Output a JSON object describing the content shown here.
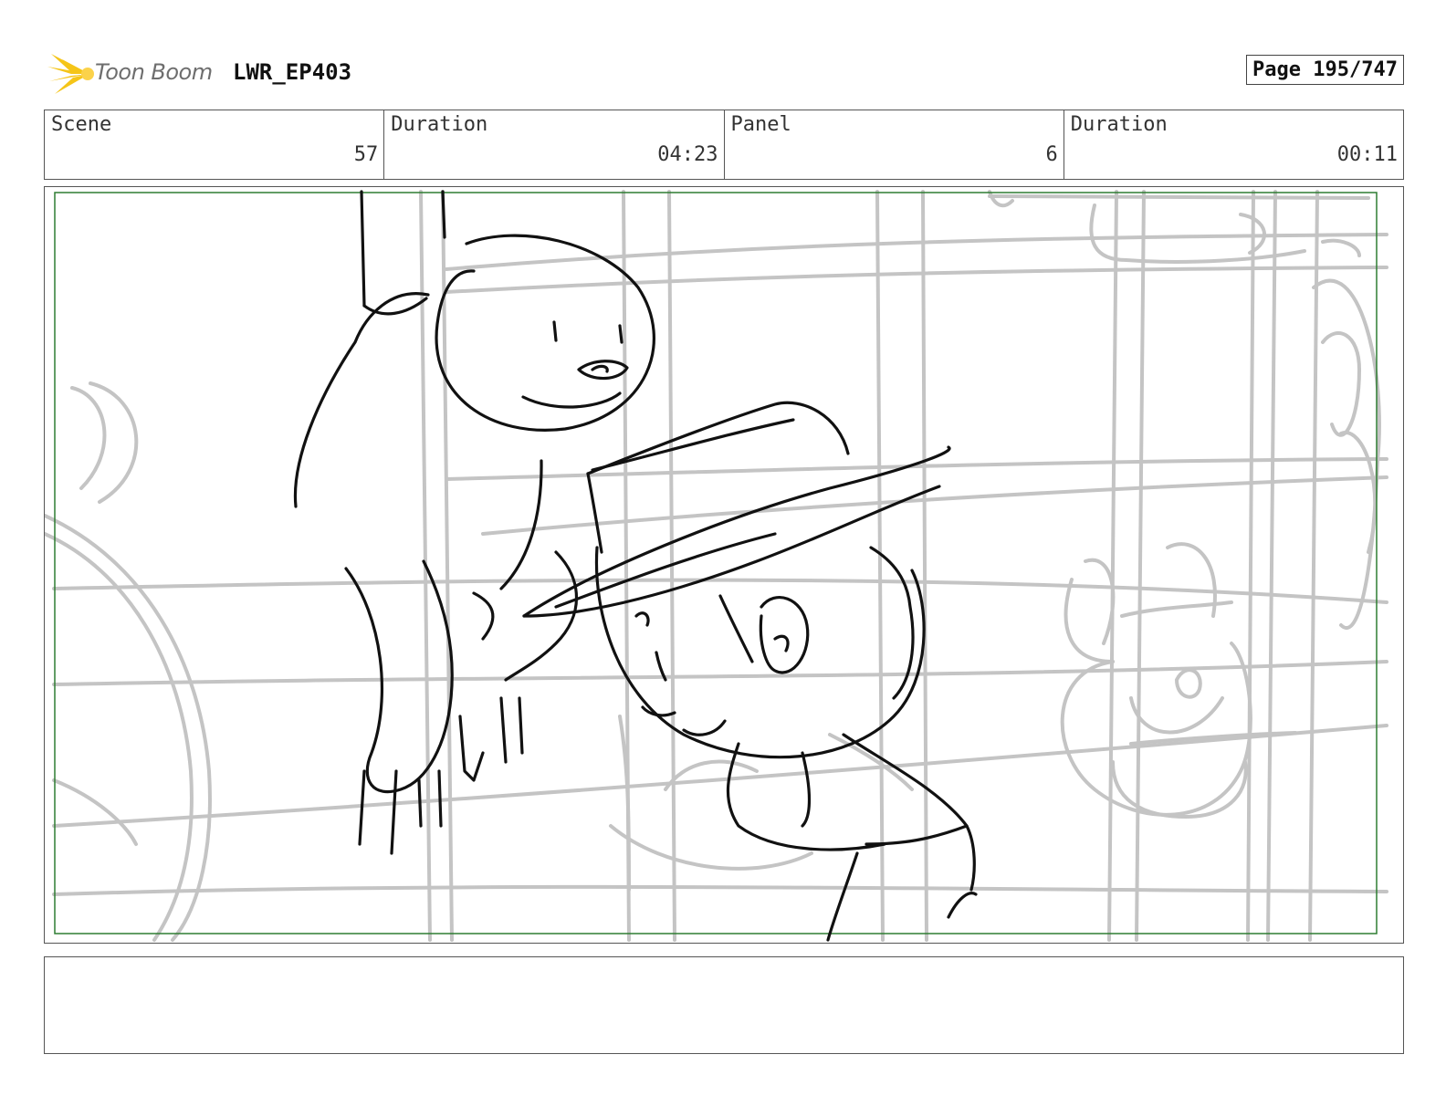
{
  "header": {
    "logo_text": "Toon Boom",
    "project": "LWR_EP403",
    "page": "Page 195/747"
  },
  "info": {
    "scene_label": "Scene",
    "scene_value": "57",
    "scene_duration_label": "Duration",
    "scene_duration_value": "04:23",
    "panel_label": "Panel",
    "panel_value": "6",
    "panel_duration_label": "Duration",
    "panel_duration_value": "00:11"
  },
  "colors": {
    "safe_frame": "#2e7d32",
    "logo_accent": "#f5c518",
    "sketch_dark": "#111111",
    "sketch_light": "#c4c4c4"
  },
  "notes": {
    "text": ""
  }
}
